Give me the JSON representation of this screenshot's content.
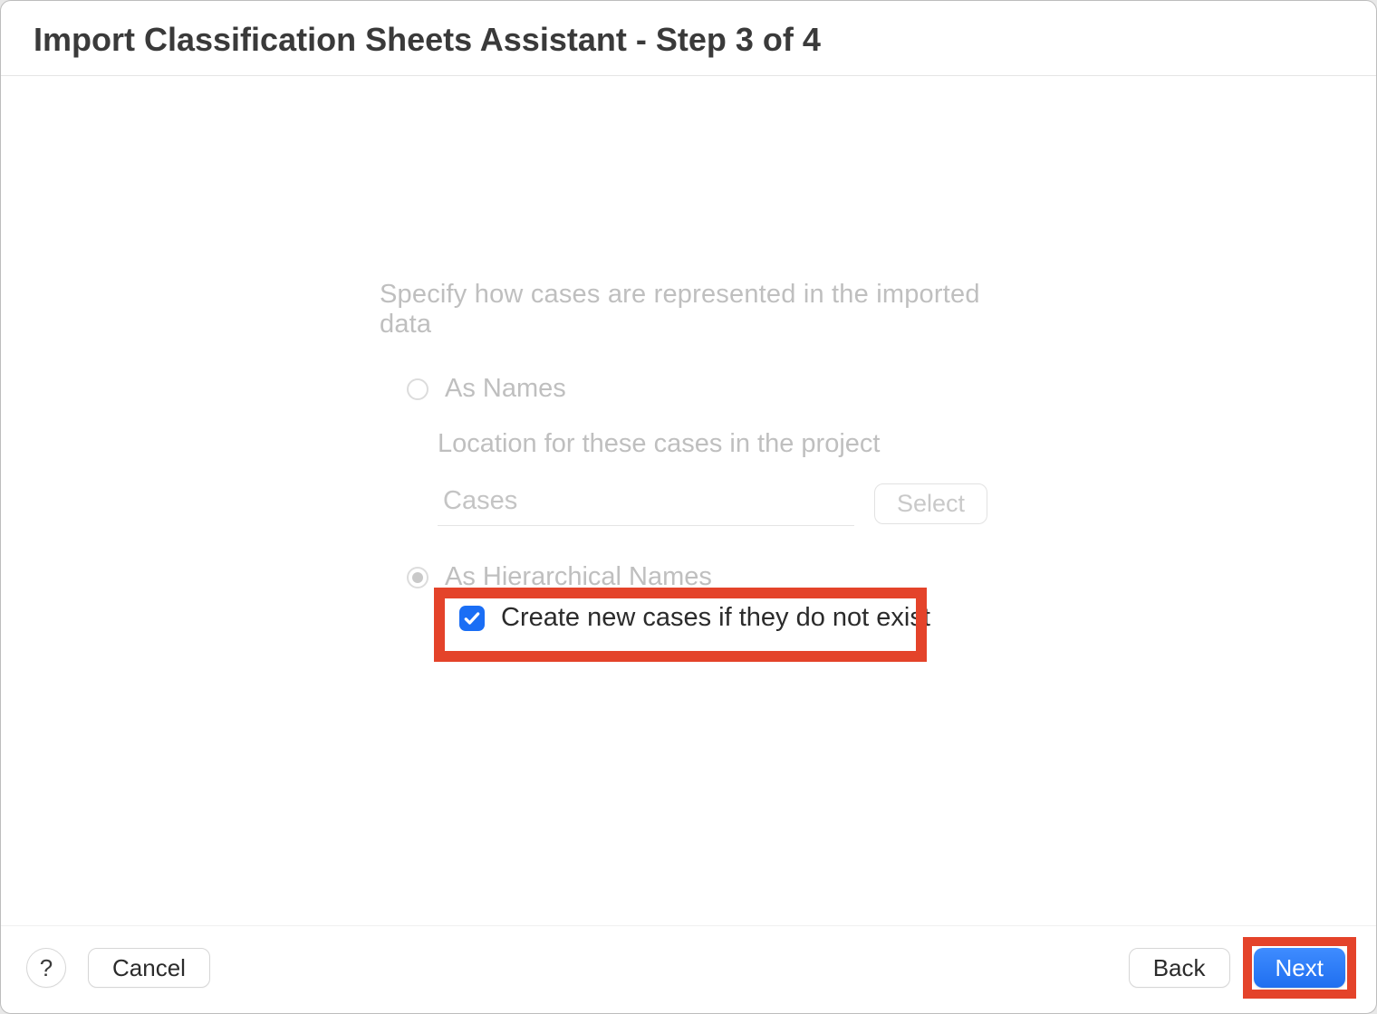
{
  "window": {
    "title": "Import Classification Sheets Assistant - Step 3 of 4"
  },
  "form": {
    "instruction": "Specify how cases are represented in the imported data",
    "radio_names_label": "As Names",
    "location_sub_label": "Location for these cases in the project",
    "location_value": "Cases",
    "select_button_label": "Select",
    "radio_hierarchical_label": "As Hierarchical Names",
    "checkbox_label": "Create new cases if they do not exist"
  },
  "footer": {
    "help_label": "?",
    "cancel_label": "Cancel",
    "back_label": "Back",
    "next_label": "Next"
  }
}
